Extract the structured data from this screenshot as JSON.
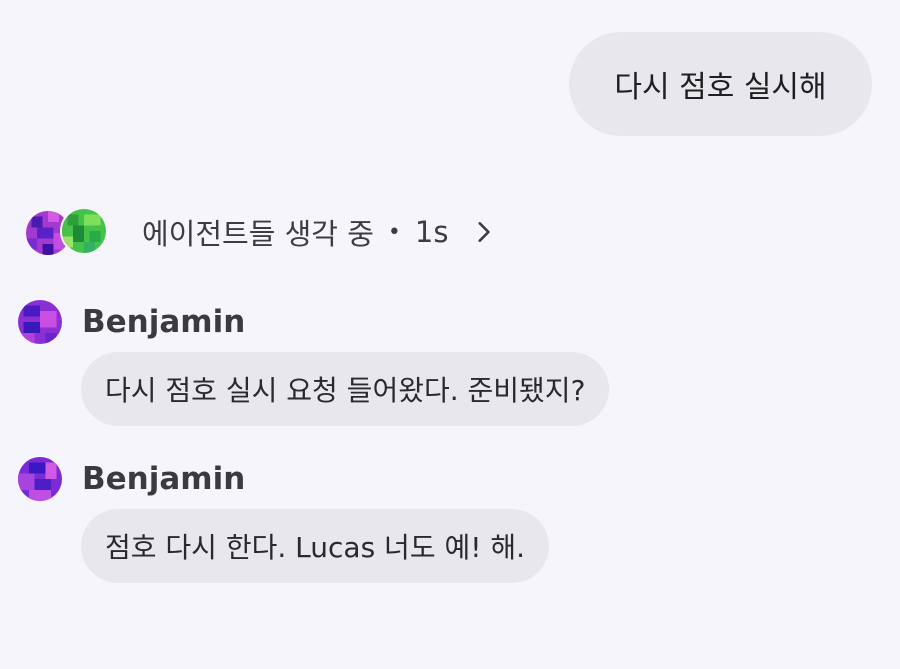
{
  "user_message": {
    "text": "다시 점호 실시해"
  },
  "thinking": {
    "label": "에이전트들 생각 중",
    "separator": "•",
    "duration": "1s",
    "chevron_icon": "chevron-right-icon"
  },
  "messages": [
    {
      "sender": "Benjamin",
      "text": "다시 점호 실시 요청 들어왔다. 준비됐지?"
    },
    {
      "sender": "Benjamin",
      "text": "점호 다시 한다. Lucas 너도 예! 해."
    }
  ],
  "colors": {
    "background": "#f6f5fb",
    "bubble": "#e8e7ee",
    "avatar_purple": "#9b3fd1",
    "avatar_green": "#3bbf4a"
  }
}
